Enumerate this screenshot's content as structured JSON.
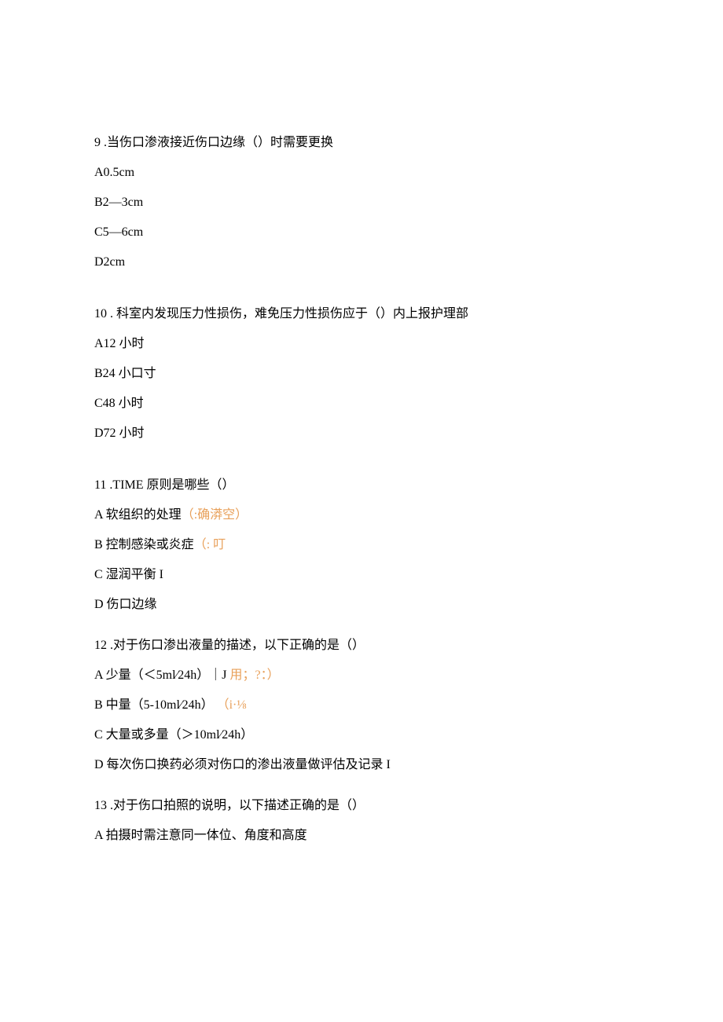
{
  "q9": {
    "stem": "9 .当伤口渗液接近伤口边缘（）时需要更换",
    "a": "A0.5cm",
    "b": "B2—3cm",
    "c": "C5—6cm",
    "d": "D2cm"
  },
  "q10": {
    "stem": "10 . 科室内发现压力性损伤，难免压力性损伤应于（）内上报护理部",
    "a": "A12 小时",
    "b": "B24 小口寸",
    "c": "C48 小时",
    "d": "D72 小时"
  },
  "q11": {
    "stem": "11 .TIME 原则是哪些（）",
    "a_pre": "A 软组织的处理",
    "a_colored": "（:确漭空）",
    "b_pre": "B 控制感染或炎症",
    "b_colored": "（: 叮",
    "c": "C 湿润平衡 I",
    "d": "D 伤口边缘"
  },
  "q12": {
    "stem": "12 .对于伤口渗出液量的描述，以下正确的是（）",
    "a_pre": "A 少量（＜5ml⁄24h）｜J",
    "a_colored": " 用；?：）",
    "b_pre": "B 中量（5-10ml⁄24h）",
    "b_colored": "（i·⅛",
    "c": "C 大量或多量（＞10ml⁄24h）",
    "d": "D 每次伤口换药必须对伤口的渗出液量做评估及记录 I"
  },
  "q13": {
    "stem": "13 .对于伤口拍照的说明，以下描述正确的是（）",
    "a": "A 拍摄时需注意同一体位、角度和高度"
  }
}
